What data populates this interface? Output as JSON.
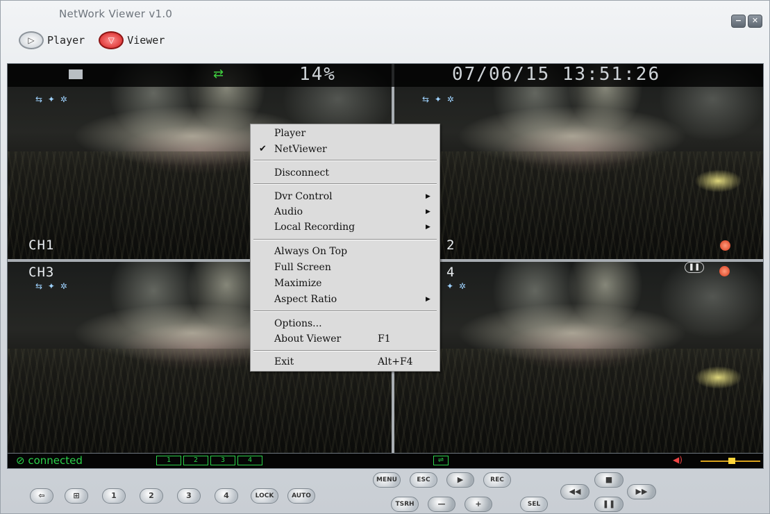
{
  "window": {
    "title": "NetWork Viewer v1.0",
    "minimize_glyph": "−",
    "close_glyph": "✕"
  },
  "mode_tabs": [
    {
      "label": "Player",
      "icon": "play-icon",
      "active": false
    },
    {
      "label": "Viewer",
      "icon": "viewer-icon",
      "active": true
    }
  ],
  "osd": {
    "percent": "14%",
    "datetime": "07/06/15 13:51:26"
  },
  "cameras": [
    {
      "label": "CH1"
    },
    {
      "label": "2"
    },
    {
      "label": "CH3"
    },
    {
      "label": "4"
    }
  ],
  "status_bar": {
    "connection": "connected",
    "channels": [
      "1",
      "2",
      "3",
      "4"
    ]
  },
  "controls": {
    "layout_buttons": [
      "⇦",
      "⊞",
      "1",
      "2",
      "3",
      "4"
    ],
    "lock": "LOCK",
    "auto": "AUTO",
    "menu": "MENU",
    "esc": "ESC",
    "rec": "REC",
    "tsrh": "TSRH",
    "minus": "—",
    "plus": "+",
    "sel": "SEL",
    "play_glyph": "▶",
    "stop_glyph": "■",
    "rewind_glyph": "◀◀",
    "pause_glyph": "❚❚",
    "forward_glyph": "▶▶"
  },
  "context_menu": {
    "items": [
      {
        "label": "Player",
        "checked": false
      },
      {
        "label": "NetViewer",
        "checked": true
      },
      {
        "label": "Disconnect"
      },
      {
        "label": "Dvr Control",
        "submenu": true
      },
      {
        "label": "Audio",
        "submenu": true
      },
      {
        "label": "Local Recording",
        "submenu": true
      },
      {
        "label": "Always On Top"
      },
      {
        "label": "Full Screen"
      },
      {
        "label": "Maximize"
      },
      {
        "label": "Aspect Ratio",
        "submenu": true
      },
      {
        "label": "Options..."
      },
      {
        "label": "About Viewer",
        "shortcut": "F1"
      },
      {
        "label": "Exit",
        "shortcut": "Alt+F4"
      }
    ]
  }
}
